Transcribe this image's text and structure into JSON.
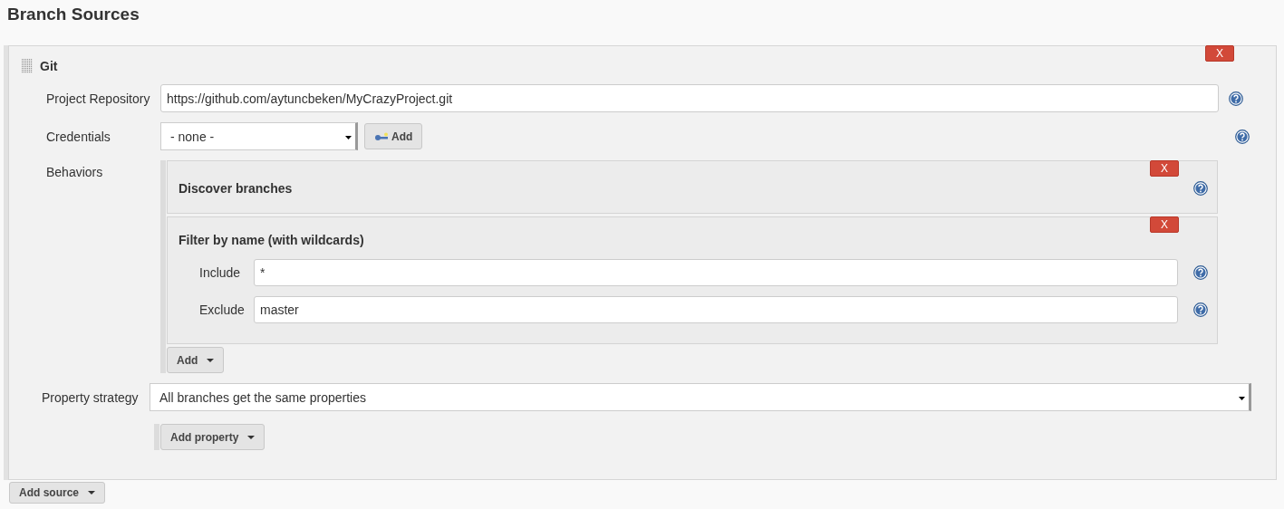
{
  "header": {
    "title": "Branch Sources"
  },
  "source": {
    "title": "Git",
    "delete_button": "X",
    "fields": [
      {
        "label": "Project Repository",
        "kind": "text",
        "value": "https://github.com/aytuncbeken/MyCrazyProject.git"
      },
      {
        "label": "Credentials",
        "kind": "select",
        "value": "- none -",
        "add_button": "Add"
      }
    ],
    "behaviors": {
      "label": "Behaviors",
      "add_button": "Add",
      "items": [
        {
          "title": "Discover branches",
          "delete_button": "X"
        },
        {
          "title": "Filter by name (with wildcards)",
          "delete_button": "X",
          "fields": [
            {
              "label": "Include",
              "value": "*"
            },
            {
              "label": "Exclude",
              "value": "master"
            }
          ]
        }
      ]
    },
    "property_strategy": {
      "label": "Property strategy",
      "value": "All branches get the same properties"
    },
    "add_property_button": "Add property"
  },
  "add_source_button": "Add source"
}
